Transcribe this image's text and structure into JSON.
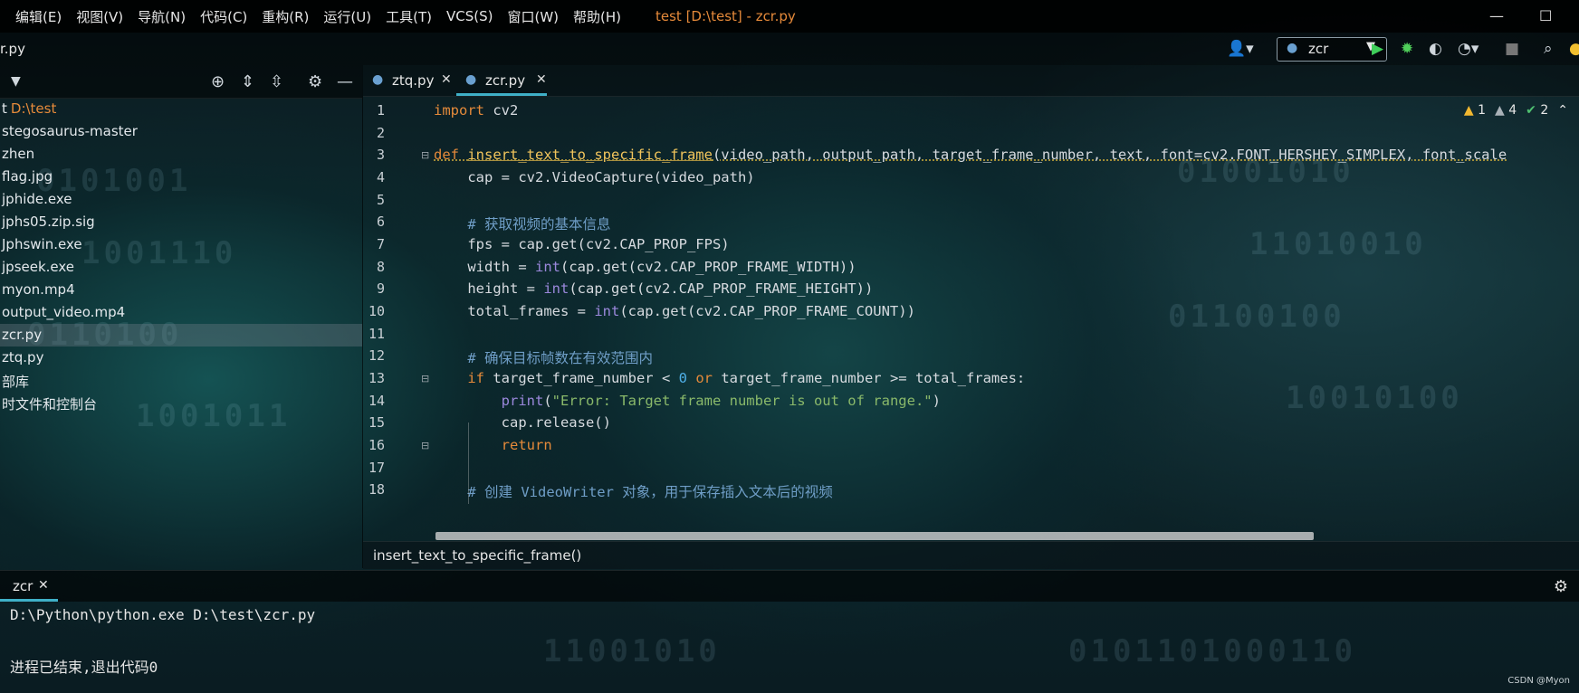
{
  "menubar": {
    "items": [
      "编辑(E)",
      "视图(V)",
      "导航(N)",
      "代码(C)",
      "重构(R)",
      "运行(U)",
      "工具(T)",
      "VCS(S)",
      "窗口(W)",
      "帮助(H)"
    ],
    "window_title": "test [D:\\test] - zcr.py",
    "minimize": "—",
    "maximize": "☐"
  },
  "navbar": {
    "breadcrumb": "r.py",
    "run_config": "zcr"
  },
  "project": {
    "items": [
      {
        "label": "t",
        "path": "D:\\test"
      },
      {
        "label": "stegosaurus-master"
      },
      {
        "label": "zhen"
      },
      {
        "label": "flag.jpg"
      },
      {
        "label": "jphide.exe"
      },
      {
        "label": "jphs05.zip.sig"
      },
      {
        "label": "Jphswin.exe"
      },
      {
        "label": "jpseek.exe"
      },
      {
        "label": "myon.mp4"
      },
      {
        "label": "output_video.mp4"
      },
      {
        "label": "zcr.py",
        "selected": true
      },
      {
        "label": "ztq.py"
      },
      {
        "label": "部库"
      },
      {
        "label": "时文件和控制台"
      }
    ]
  },
  "tabs": [
    {
      "label": "ztq.py",
      "active": false
    },
    {
      "label": "zcr.py",
      "active": true
    }
  ],
  "inspections": {
    "warnings": "1",
    "weak_warnings": "4",
    "ok": "2"
  },
  "code_lines": [
    "1",
    "2",
    "3",
    "4",
    "5",
    "6",
    "7",
    "8",
    "9",
    "10",
    "11",
    "12",
    "13",
    "14",
    "15",
    "16",
    "17",
    "18"
  ],
  "code": {
    "l1_kw": "import",
    "l1_rest": " cv2",
    "l3_kw": "def",
    "l3_fn": "insert_text_to_specific_frame",
    "l3_rest": "(video_path, output_path, target_frame_number, text, font=cv2.FONT_HERSHEY_SIMPLEX, font_scale",
    "l4": "    cap = cv2.VideoCapture(video_path)",
    "l6": "    # 获取视频的基本信息",
    "l7": "    fps = cap.get(cv2.CAP_PROP_FPS)",
    "l8_a": "    width = ",
    "l8_bi": "int",
    "l8_b": "(cap.get(cv2.CAP_PROP_FRAME_WIDTH))",
    "l9_a": "    height = ",
    "l9_bi": "int",
    "l9_b": "(cap.get(cv2.CAP_PROP_FRAME_HEIGHT))",
    "l10_a": "    total_frames = ",
    "l10_bi": "int",
    "l10_b": "(cap.get(cv2.CAP_PROP_FRAME_COUNT))",
    "l12": "    # 确保目标帧数在有效范围内",
    "l13_kw": "    if",
    "l13_a": " target_frame_number < ",
    "l13_num": "0",
    "l13_or": " or",
    "l13_b": " target_frame_number >= total_frames:",
    "l14_a": "        ",
    "l14_bi": "print",
    "l14_p": "(",
    "l14_str": "\"Error: Target frame number is out of range.\"",
    "l14_e": ")",
    "l15": "        cap.release()",
    "l16_kw": "        return",
    "l18": "    # 创建 VideoWriter 对象，用于保存插入文本后的视频"
  },
  "breadcrumb_bar": "insert_text_to_specific_frame()",
  "run_panel": {
    "tab_label": "zcr",
    "lines": [
      "D:\\Python\\python.exe D:\\test\\zcr.py",
      "",
      "进程已结束,退出代码0"
    ]
  },
  "watermark": "CSDN @Myon⁠",
  "colors": {
    "accent": "#3fb0c8",
    "keyword": "#e58a3a",
    "function": "#f2c55c",
    "comment": "#6f9ec7"
  }
}
